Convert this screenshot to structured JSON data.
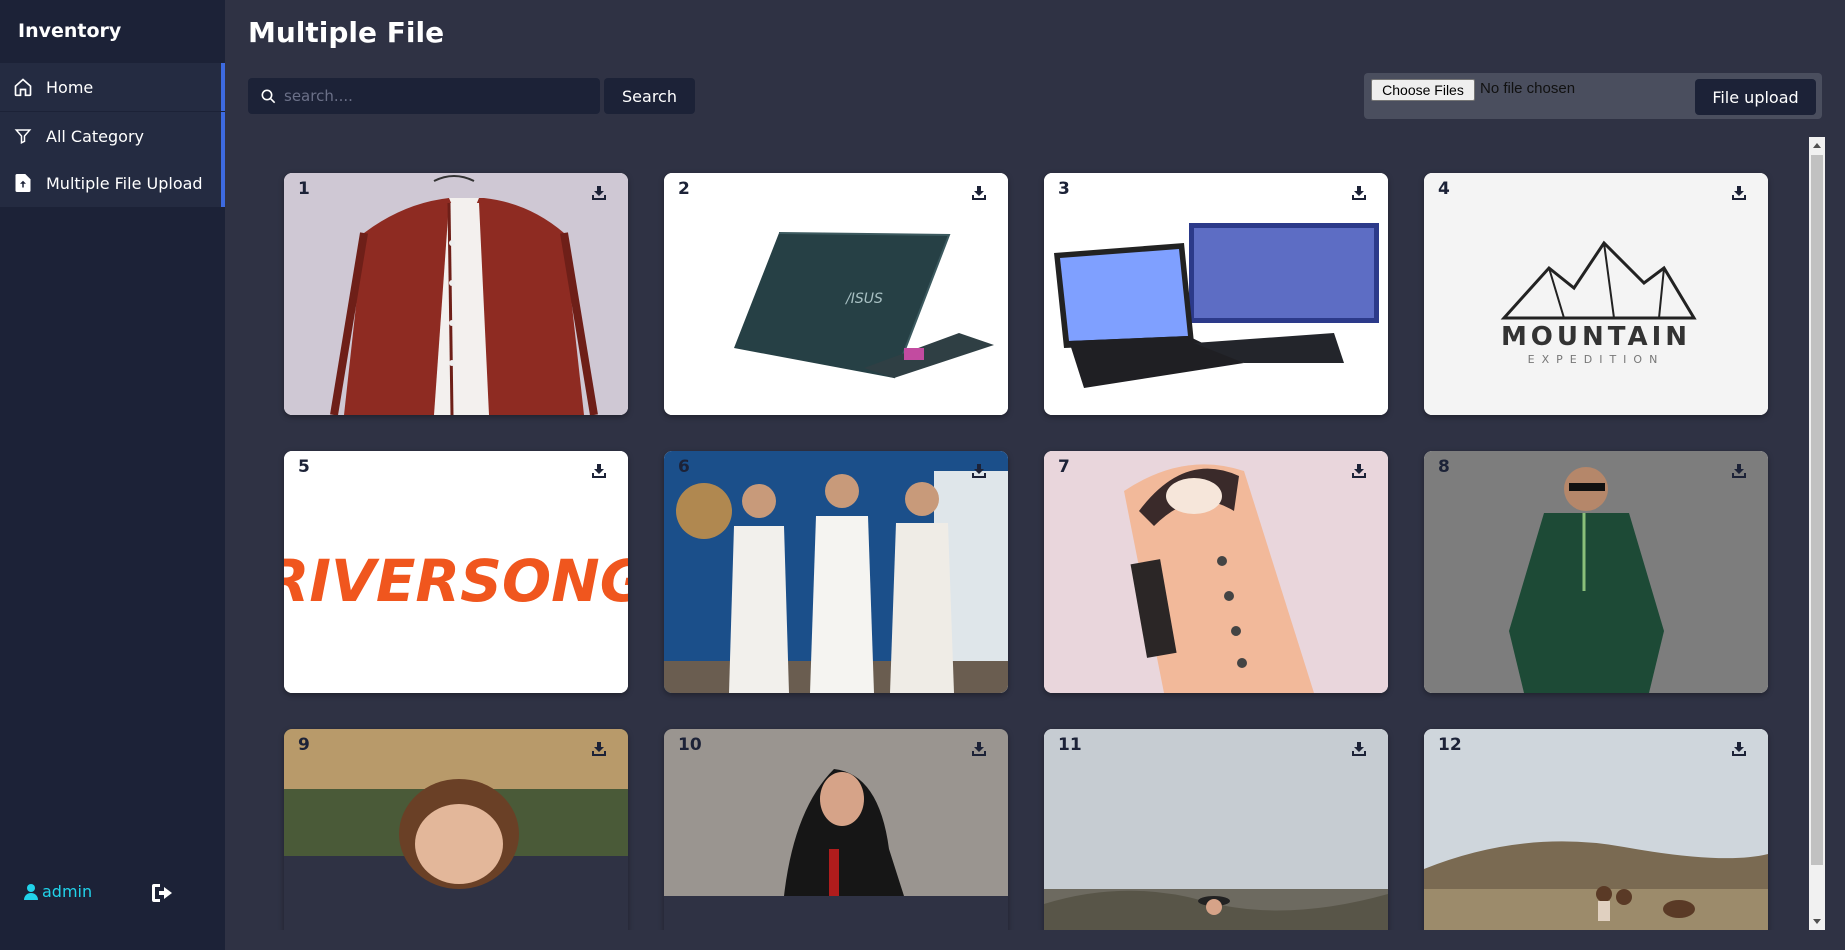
{
  "app": {
    "title": "Inventory"
  },
  "sidebar": {
    "items": [
      {
        "label": "Home",
        "icon": "home-icon"
      },
      {
        "label": "All Category",
        "icon": "filter-icon"
      },
      {
        "label": "Multiple File Upload",
        "icon": "file-upload-icon"
      }
    ],
    "user": {
      "name": "admin",
      "icon": "user-icon"
    },
    "logout_icon": "logout-icon"
  },
  "main": {
    "title": "Multiple File",
    "search": {
      "placeholder": "search....",
      "button_label": "Search"
    },
    "upload": {
      "choose_label": "Choose Files",
      "status": "No file chosen",
      "button_label": "File upload"
    }
  },
  "files": [
    {
      "number": "1",
      "subject": "red shirt"
    },
    {
      "number": "2",
      "subject": "asus laptop"
    },
    {
      "number": "3",
      "subject": "laptop"
    },
    {
      "number": "4",
      "subject": "mountain logo"
    },
    {
      "number": "5",
      "subject": "riversong logo",
      "logo_text": "RIVERSONG"
    },
    {
      "number": "6",
      "subject": "three men in panjabi"
    },
    {
      "number": "7",
      "subject": "peach panjabi"
    },
    {
      "number": "8",
      "subject": "man in green panjabi"
    },
    {
      "number": "9",
      "subject": "woman portrait"
    },
    {
      "number": "10",
      "subject": "woman at stone wall"
    },
    {
      "number": "11",
      "subject": "woman in field"
    },
    {
      "number": "12",
      "subject": "two people in field"
    }
  ],
  "logos": {
    "mountain_title": "MOUNTAIN",
    "mountain_sub": "EXPEDITION"
  },
  "colors": {
    "accent": "#3d6ae0",
    "user": "#21d3ea",
    "sidebar": "#1c2237",
    "background": "#2f3244"
  }
}
